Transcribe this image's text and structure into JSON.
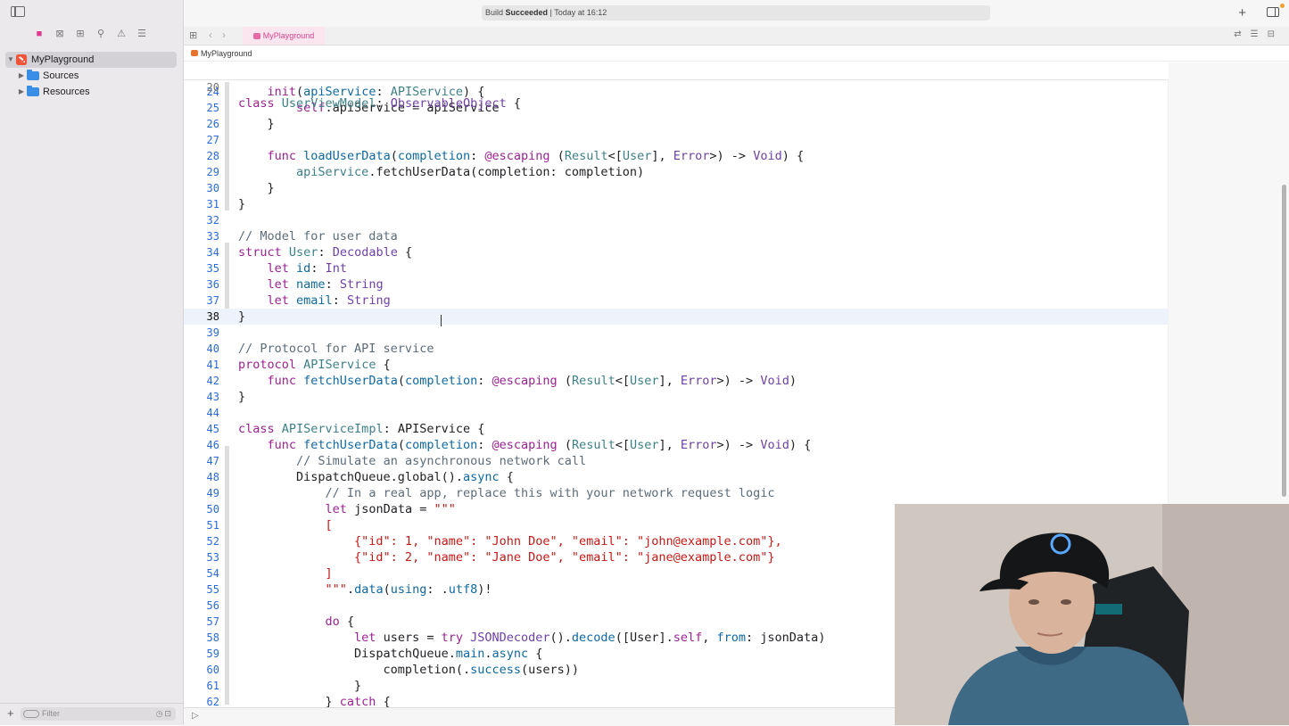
{
  "sidebar": {
    "filter_placeholder": "Filter",
    "nav_icons": [
      "folder-icon",
      "source-control-icon",
      "symbol-icon",
      "find-icon",
      "issue-icon",
      "report-icon"
    ],
    "tree": [
      {
        "label": "MyPlayground",
        "icon": "swift-icon",
        "expanded": true
      },
      {
        "label": "Sources",
        "icon": "folder-icon"
      },
      {
        "label": "Resources",
        "icon": "folder-icon"
      }
    ]
  },
  "toolbar": {
    "build_prefix": "Build ",
    "build_status": "Succeeded",
    "build_time": " | Today at 16:12"
  },
  "tab": {
    "label": "MyPlayground"
  },
  "jumpbar": {
    "label": "MyPlayground"
  },
  "editor": {
    "sticky": {
      "num": "20"
    },
    "lines": [
      {
        "num": "24"
      },
      {
        "num": "25"
      },
      {
        "num": "26"
      },
      {
        "num": "27"
      },
      {
        "num": "28"
      },
      {
        "num": "29"
      },
      {
        "num": "30"
      },
      {
        "num": "31"
      },
      {
        "num": "32"
      },
      {
        "num": "33"
      },
      {
        "num": "34"
      },
      {
        "num": "35"
      },
      {
        "num": "36"
      },
      {
        "num": "37"
      },
      {
        "num": "38"
      },
      {
        "num": "39"
      },
      {
        "num": "40"
      },
      {
        "num": "41"
      },
      {
        "num": "42"
      },
      {
        "num": "43"
      },
      {
        "num": "44"
      },
      {
        "num": "45"
      },
      {
        "num": "46"
      },
      {
        "num": "47"
      },
      {
        "num": "48"
      },
      {
        "num": "49"
      },
      {
        "num": "50"
      },
      {
        "num": "51"
      },
      {
        "num": "52"
      },
      {
        "num": "53"
      },
      {
        "num": "54"
      },
      {
        "num": "55"
      },
      {
        "num": "56"
      },
      {
        "num": "57"
      },
      {
        "num": "58"
      },
      {
        "num": "59"
      },
      {
        "num": "60"
      },
      {
        "num": "61"
      },
      {
        "num": "62"
      }
    ],
    "current_line": "38"
  },
  "colors": {
    "keyword": "#9b2393",
    "type": "#3e8087",
    "function": "#0f68a0",
    "comment": "#5d6c79",
    "string": "#c41a16",
    "accent": "#e1378f"
  }
}
